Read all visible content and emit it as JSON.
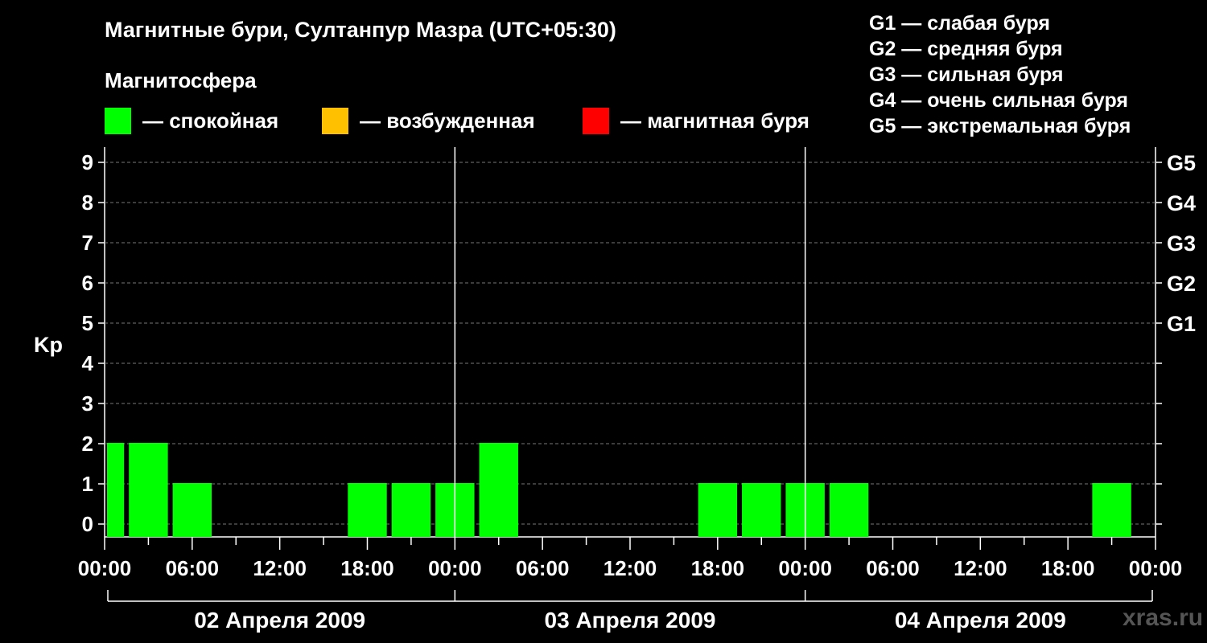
{
  "title": "Магнитные бури, Султанпур Мазра (UTC+05:30)",
  "magnetosphere_heading": "Магнитосфера",
  "legend": [
    {
      "label": "— спокойная",
      "color": "#00ff00"
    },
    {
      "label": "— возбужденная",
      "color": "#ffc000"
    },
    {
      "label": "— магнитная буря",
      "color": "#ff0000"
    }
  ],
  "g_scale": [
    "G1 — слабая буря",
    "G2 — средняя буря",
    "G3 — сильная буря",
    "G4 — очень сильная буря",
    "G5 — экстремальная буря"
  ],
  "watermark": "xras.ru",
  "chart_data": {
    "type": "bar",
    "ylabel": "Kp",
    "ylim": [
      0,
      9
    ],
    "yticks": [
      "0",
      "1",
      "2",
      "3",
      "4",
      "5",
      "6",
      "7",
      "8",
      "9"
    ],
    "right_labels": [
      {
        "kp": 5,
        "label": "G1"
      },
      {
        "kp": 6,
        "label": "G2"
      },
      {
        "kp": 7,
        "label": "G3"
      },
      {
        "kp": 8,
        "label": "G4"
      },
      {
        "kp": 9,
        "label": "G5"
      }
    ],
    "xticks": [
      "00:00",
      "06:00",
      "12:00",
      "18:00",
      "00:00",
      "06:00",
      "12:00",
      "18:00",
      "00:00",
      "06:00",
      "12:00",
      "18:00",
      "00:00"
    ],
    "days": [
      "02 Апреля 2009",
      "03 Апреля 2009",
      "04 Апреля 2009"
    ],
    "bar_color": "#00ff00",
    "bars": [
      {
        "start_hour": 0,
        "end_hour": 1.5,
        "kp": 2
      },
      {
        "start_hour": 1.5,
        "end_hour": 4.5,
        "kp": 2
      },
      {
        "start_hour": 4.5,
        "end_hour": 7.5,
        "kp": 1
      },
      {
        "start_hour": 16.5,
        "end_hour": 19.5,
        "kp": 1
      },
      {
        "start_hour": 19.5,
        "end_hour": 22.5,
        "kp": 1
      },
      {
        "start_hour": 22.5,
        "end_hour": 25.5,
        "kp": 1
      },
      {
        "start_hour": 25.5,
        "end_hour": 28.5,
        "kp": 2
      },
      {
        "start_hour": 40.5,
        "end_hour": 43.5,
        "kp": 1
      },
      {
        "start_hour": 43.5,
        "end_hour": 46.5,
        "kp": 1
      },
      {
        "start_hour": 46.5,
        "end_hour": 49.5,
        "kp": 1
      },
      {
        "start_hour": 49.5,
        "end_hour": 52.5,
        "kp": 1
      },
      {
        "start_hour": 67.5,
        "end_hour": 70.5,
        "kp": 1
      }
    ],
    "grid": "dashed horizontal lines",
    "day_separators": "solid vertical lines"
  }
}
